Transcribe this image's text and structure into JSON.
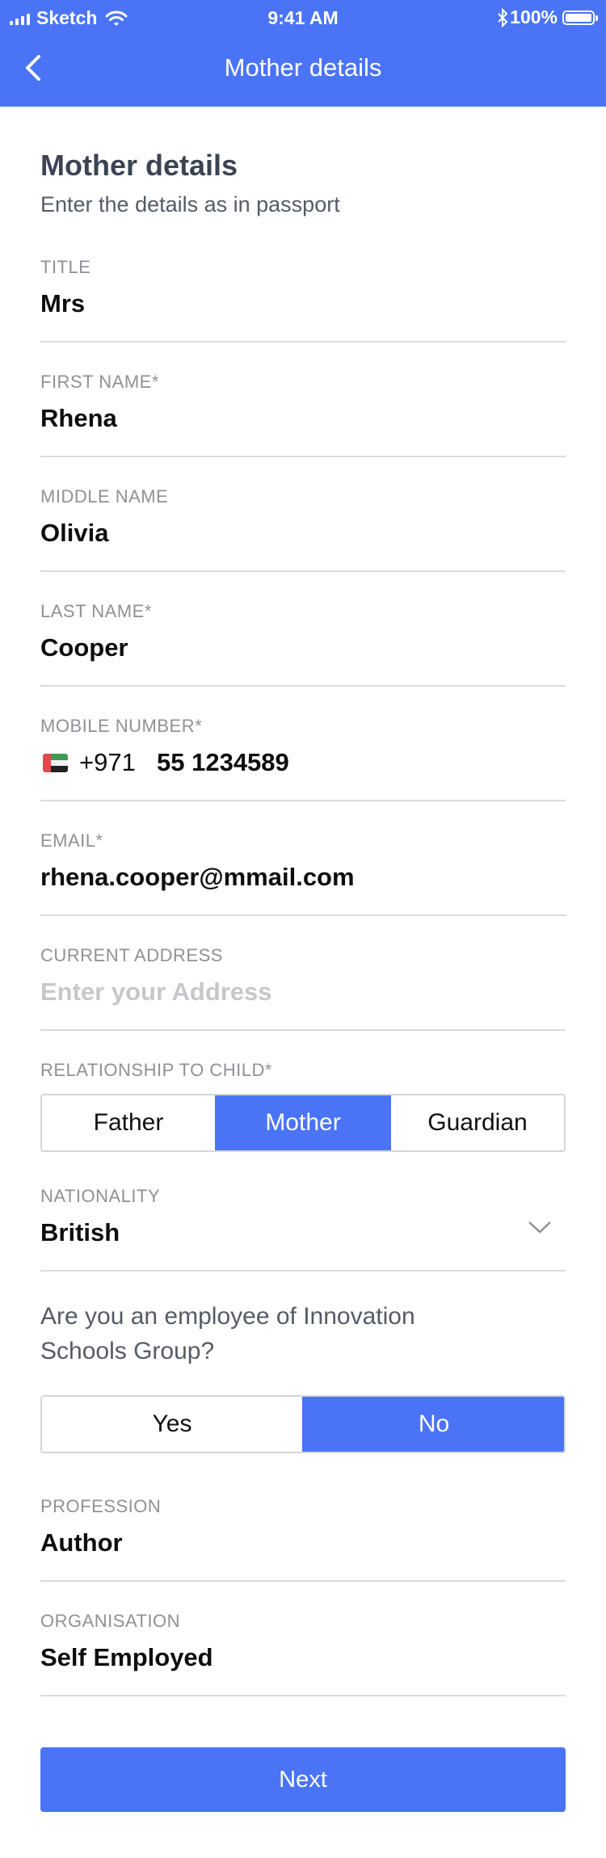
{
  "status_bar": {
    "carrier": "Sketch",
    "time": "9:41 AM",
    "battery": "100%"
  },
  "nav": {
    "title": "Mother details"
  },
  "form": {
    "heading": "Mother details",
    "subheading": "Enter the details as in passport",
    "title": {
      "label": "TITLE",
      "value": "Mrs"
    },
    "first_name": {
      "label": "FIRST NAME*",
      "value": "Rhena"
    },
    "middle_name": {
      "label": "MIDDLE NAME",
      "value": "Olivia"
    },
    "last_name": {
      "label": "LAST NAME*",
      "value": "Cooper"
    },
    "mobile": {
      "label": "MOBILE NUMBER*",
      "country_code": "+971",
      "value": "55 1234589"
    },
    "email": {
      "label": "EMAIL*",
      "value": "rhena.cooper@mmail.com"
    },
    "address": {
      "label": "CURRENT ADDRESS",
      "placeholder": "Enter your Address"
    },
    "relationship": {
      "label": "RELATIONSHIP TO CHILD*",
      "options": [
        "Father",
        "Mother",
        "Guardian"
      ],
      "selected": "Mother"
    },
    "nationality": {
      "label": "NATIONALITY",
      "value": "British"
    },
    "employee_question": "Are you an employee of Innovation Schools Group?",
    "employee": {
      "options": [
        "Yes",
        "No"
      ],
      "selected": "No"
    },
    "profession": {
      "label": "PROFESSION",
      "value": "Author"
    },
    "organisation": {
      "label": "ORGANISATION",
      "value": "Self Employed"
    },
    "next_label": "Next"
  },
  "colors": {
    "accent": "#4a74f5",
    "label": "#8e9196",
    "divider": "#d9dbdf",
    "placeholder": "#c5c7cb"
  },
  "icons": [
    "signal-icon",
    "wifi-icon",
    "bluetooth-icon",
    "battery-icon",
    "back-arrow-icon",
    "uae-flag-icon",
    "chevron-down-icon"
  ]
}
